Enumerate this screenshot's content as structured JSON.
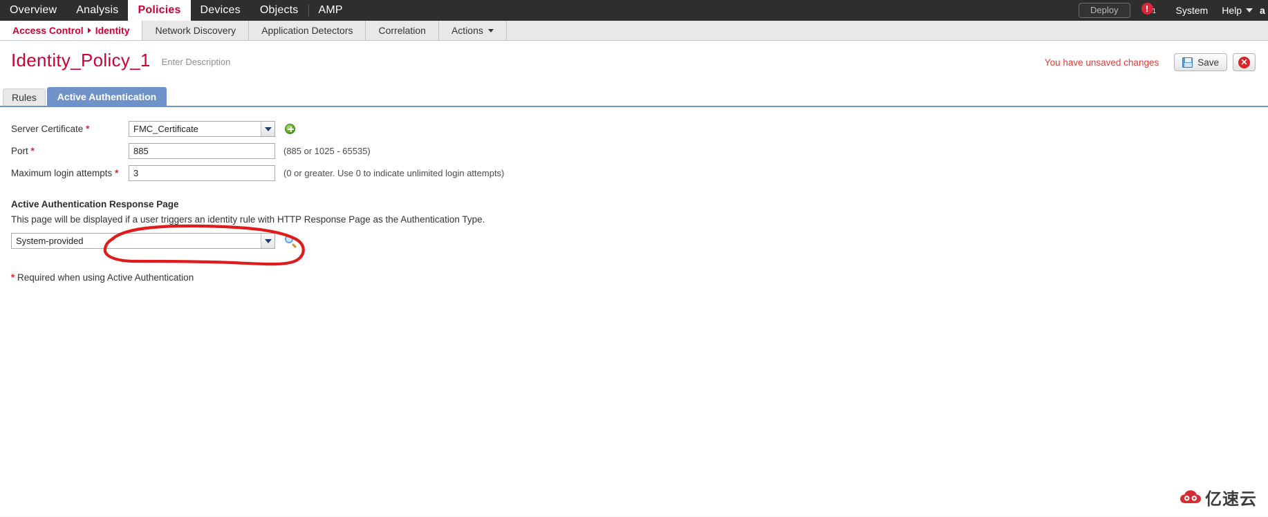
{
  "topnav": {
    "items": [
      {
        "label": "Overview",
        "active": false
      },
      {
        "label": "Analysis",
        "active": false
      },
      {
        "label": "Policies",
        "active": true
      },
      {
        "label": "Devices",
        "active": false
      },
      {
        "label": "Objects",
        "active": false
      },
      {
        "label": "AMP",
        "active": false
      }
    ],
    "deploy_label": "Deploy",
    "alert_glyph": "!",
    "alert_count": "1",
    "system_label": "System",
    "help_label": "Help",
    "user_label": "a"
  },
  "subnav": {
    "breadcrumb_first": "Access Control",
    "breadcrumb_second": "Identity",
    "items": [
      {
        "label": "Network Discovery"
      },
      {
        "label": "Application Detectors"
      },
      {
        "label": "Correlation"
      },
      {
        "label": "Actions"
      }
    ]
  },
  "header": {
    "title": "Identity_Policy_1",
    "description_placeholder": "Enter Description",
    "unsaved_message": "You have unsaved changes",
    "save_label": "Save",
    "cancel_glyph": "✕"
  },
  "tabs": [
    {
      "label": "Rules",
      "active": false
    },
    {
      "label": "Active Authentication",
      "active": true
    }
  ],
  "form": {
    "server_certificate": {
      "label": "Server Certificate",
      "required_mark": "*",
      "value": "FMC_Certificate",
      "add_icon": "add-circle-icon"
    },
    "port": {
      "label": "Port",
      "required_mark": "*",
      "value": "885",
      "hint": "(885 or 1025 - 65535)"
    },
    "max_login_attempts": {
      "label": "Maximum login attempts",
      "required_mark": "*",
      "value": "3",
      "hint": "(0 or greater. Use 0 to indicate unlimited login attempts)"
    },
    "response_page": {
      "heading": "Active Authentication Response Page",
      "description": "This page will be displayed if a user triggers an identity rule with HTTP Response Page as the Authentication Type.",
      "value": "System-provided",
      "search_icon": "magnifier-icon"
    },
    "footnote_mark": "*",
    "footnote": "Required when using Active Authentication"
  },
  "annotation": {
    "type": "hand-drawn-ellipse",
    "color": "#e01b1b",
    "targets": "server-certificate-dropdown"
  },
  "watermark": {
    "text": "亿速云",
    "logo_color": "#d2232a"
  },
  "colors": {
    "brand_red": "#cc0033",
    "nav_bg": "#2e2e2e",
    "tab_active": "#6f93c8",
    "annotation_red": "#e01b1b"
  }
}
